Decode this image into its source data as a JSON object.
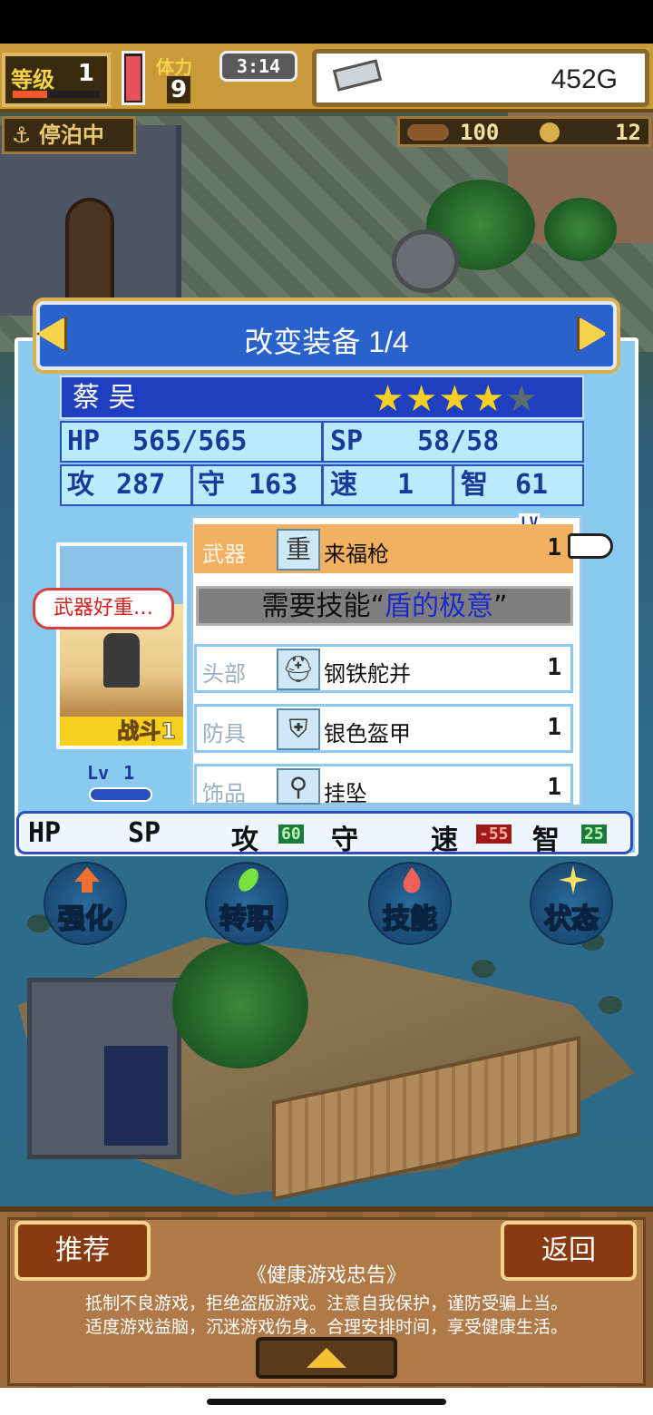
{
  "hud": {
    "level_label": "等级",
    "level": "1",
    "stamina_label": "体力",
    "stamina": "9",
    "time": "3:14",
    "gold": "452G",
    "status": "停泊中",
    "resource_a": "100",
    "resource_b": "12"
  },
  "panel": {
    "title": "改变装备 1/4",
    "character": {
      "name": "蔡 吴",
      "stars_filled": 4,
      "stars_total": 5,
      "hp_label": "HP",
      "hp": "565/565",
      "sp_label": "SP",
      "sp": "58/58",
      "atk_label": "攻",
      "atk": "287",
      "def_label": "守",
      "def": "163",
      "spd_label": "速",
      "spd": "1",
      "int_label": "智",
      "int": "61",
      "speech": "武器好重…",
      "badge": "战斗1",
      "lv_label": "Lv",
      "lv": "1"
    },
    "lv_tag": "LV",
    "equipment": [
      {
        "kind": "武器",
        "icon": "重",
        "icon_name": "heavy-weapon-icon",
        "name": "来福枪",
        "lv": "1"
      },
      {
        "kind": "头部",
        "icon": "⛑",
        "icon_name": "helmet-icon",
        "name": "钢铁舵并",
        "lv": "1"
      },
      {
        "kind": "防具",
        "icon": "⛨",
        "icon_name": "armor-icon",
        "name": "银色盔甲",
        "lv": "1"
      },
      {
        "kind": "饰品",
        "icon": "⚲",
        "icon_name": "pendant-icon",
        "name": "挂坠",
        "lv": "1"
      }
    ],
    "skill_required_prefix": "需要技能“",
    "skill_required_name": "盾的极意",
    "skill_required_suffix": "”",
    "diff": {
      "hp_label": "HP",
      "sp_label": "SP",
      "atk_label": "攻",
      "atk_delta": "60",
      "def_label": "守",
      "spd_label": "速",
      "spd_delta": "-55",
      "int_label": "智",
      "int_delta": "25"
    }
  },
  "actions": [
    {
      "label": "强化",
      "icon": "arrow-up-icon",
      "color": "#f07030"
    },
    {
      "label": "转职",
      "icon": "leaf-icon",
      "color": "#7ae040"
    },
    {
      "label": "技能",
      "icon": "flame-icon",
      "color": "#f0605a"
    },
    {
      "label": "状态",
      "icon": "sparkle-icon",
      "color": "#f5e060"
    }
  ],
  "footer": {
    "recommend": "推荐",
    "back": "返回",
    "notice_title": "《健康游戏忠告》",
    "notice_line1": "抵制不良游戏，拒绝盗版游戏。注意自我保护，谨防受骗上当。",
    "notice_line2": "适度游戏益脑，沉迷游戏伤身。合理安排时间，享受健康生活。"
  }
}
